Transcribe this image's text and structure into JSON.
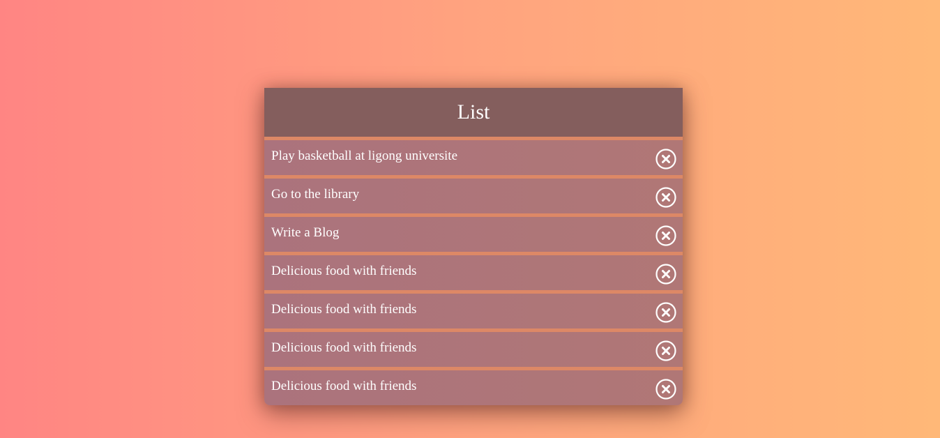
{
  "list": {
    "title": "List",
    "items": [
      {
        "text": "Play basketball at ligong universite",
        "action_icon": "close-circle-icon"
      },
      {
        "text": "Go to the library",
        "action_icon": "close-circle-icon"
      },
      {
        "text": "Write a Blog",
        "action_icon": "close-circle-icon"
      },
      {
        "text": "Delicious food with friends",
        "action_icon": "close-circle-icon"
      },
      {
        "text": "Delicious food with friends",
        "action_icon": "close-circle-icon"
      },
      {
        "text": "Delicious food with friends",
        "action_icon": "close-circle-icon"
      },
      {
        "text": "Delicious food with friends",
        "action_icon": "close-circle-icon"
      }
    ]
  },
  "colors": {
    "background_start": "#ff8583",
    "background_end": "#ffb878",
    "header": "#845e5d",
    "item": "#ad747b",
    "separator": "#dd8866",
    "text": "#ffffff"
  }
}
